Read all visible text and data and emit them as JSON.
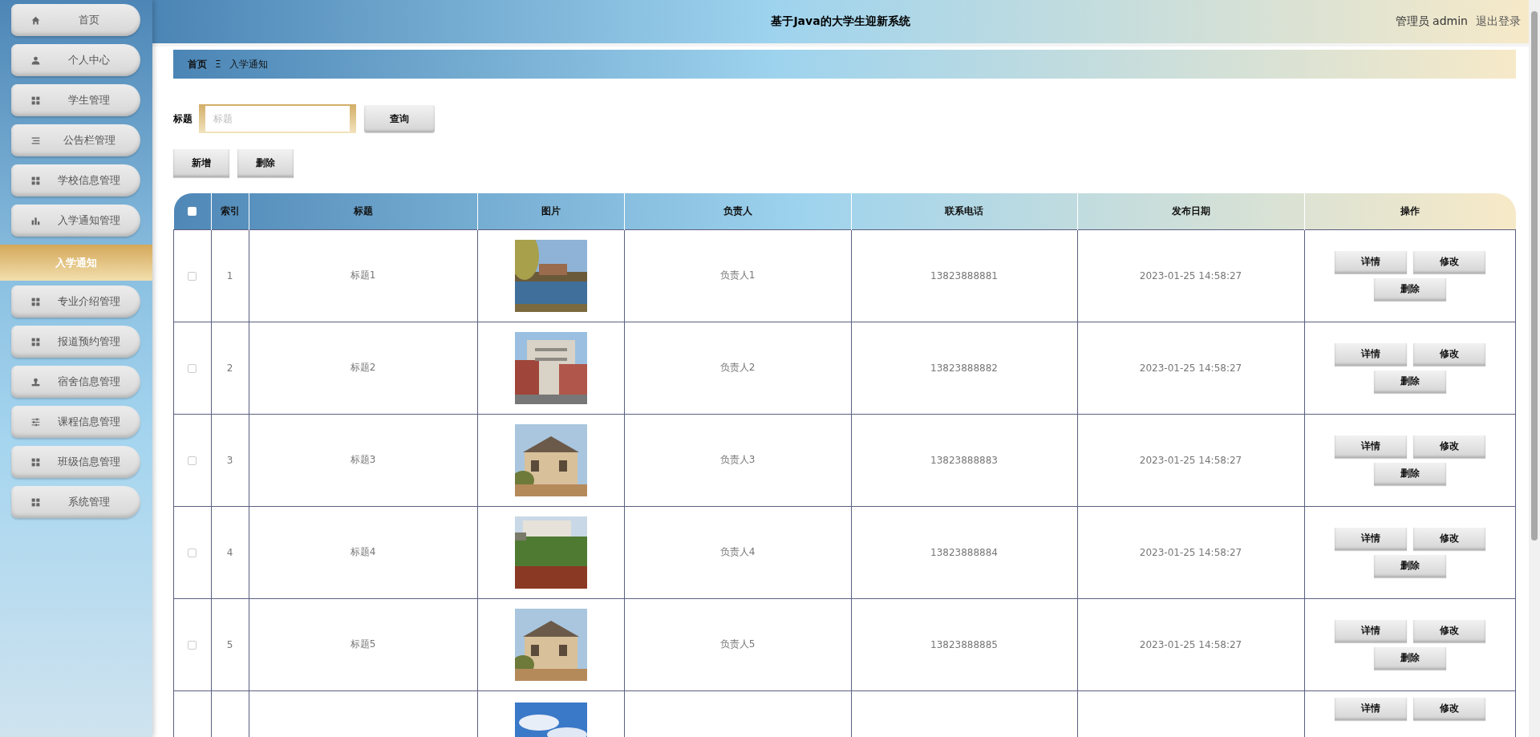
{
  "header": {
    "title": "基于Java的大学生迎新系统",
    "user": "管理员 admin",
    "logout": "退出登录"
  },
  "sidebar": {
    "items": [
      {
        "label": "首页"
      },
      {
        "label": "个人中心"
      },
      {
        "label": "学生管理"
      },
      {
        "label": "公告栏管理"
      },
      {
        "label": "学校信息管理"
      },
      {
        "label": "入学通知管理",
        "children": [
          {
            "label": "入学通知",
            "selected": true
          }
        ]
      },
      {
        "label": "专业介绍管理"
      },
      {
        "label": "报道预约管理"
      },
      {
        "label": "宿舍信息管理"
      },
      {
        "label": "课程信息管理"
      },
      {
        "label": "班级信息管理"
      },
      {
        "label": "系统管理"
      }
    ]
  },
  "breadcrumb": {
    "home": "首页",
    "separator": "Ξ",
    "current": "入学通知"
  },
  "search": {
    "label": "标题",
    "placeholder": "标题",
    "button": "查询"
  },
  "toolbar": [
    "新增",
    "删除"
  ],
  "table": {
    "header_checkbox": {
      "checked": false
    },
    "columns": [
      "索引",
      "标题",
      "图片",
      "负责人",
      "联系电话",
      "发布日期",
      "操作"
    ],
    "rows": [
      {
        "checked": false,
        "index": "1",
        "title": "标题1",
        "picture": {
          "kind": "picture"
        },
        "person": "负责人1",
        "phone": "13823888881",
        "date": "2023-01-25 14:58:27",
        "actions": [
          "详情",
          "修改",
          "删除"
        ]
      },
      {
        "checked": false,
        "index": "2",
        "title": "标题2",
        "picture": {
          "kind": "picture"
        },
        "person": "负责人2",
        "phone": "13823888882",
        "date": "2023-01-25 14:58:27",
        "actions": [
          "详情",
          "修改",
          "删除"
        ]
      },
      {
        "checked": false,
        "index": "3",
        "title": "标题3",
        "picture": {
          "kind": "picture"
        },
        "person": "负责人3",
        "phone": "13823888883",
        "date": "2023-01-25 14:58:27",
        "actions": [
          "详情",
          "修改",
          "删除"
        ]
      },
      {
        "checked": false,
        "index": "4",
        "title": "标题4",
        "picture": {
          "kind": "picture"
        },
        "person": "负责人4",
        "phone": "13823888884",
        "date": "2023-01-25 14:58:27",
        "actions": [
          "详情",
          "修改",
          "删除"
        ]
      },
      {
        "checked": false,
        "index": "5",
        "title": "标题5",
        "picture": {
          "kind": "picture"
        },
        "person": "负责人5",
        "phone": "13823888885",
        "date": "2023-01-25 14:58:27",
        "actions": [
          "详情",
          "修改",
          "删除"
        ]
      },
      {
        "picture": {
          "kind": "picture"
        },
        "actions": [
          "详情",
          "修改"
        ]
      }
    ]
  }
}
